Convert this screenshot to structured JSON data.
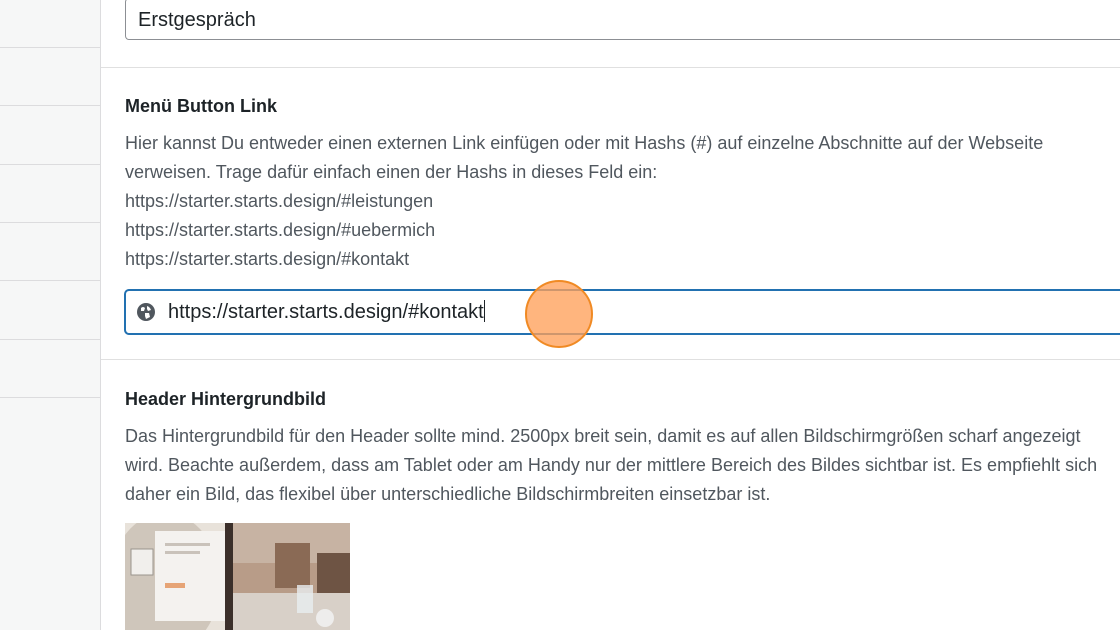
{
  "sidebar": {
    "rows": 8
  },
  "button_text_field": {
    "value": "Erstgespräch"
  },
  "menu_button_link": {
    "label": "Menü Button Link",
    "description_lines": [
      "Hier kannst Du entweder einen externen Link einfügen oder mit Hashs (#) auf einzelne Abschnitte auf der Webseite",
      "verweisen. Trage dafür einfach einen der Hashs in dieses Feld ein:",
      "https://starter.starts.design/#leistungen",
      "https://starter.starts.design/#uebermich",
      "https://starter.starts.design/#kontakt"
    ],
    "input_value": "https://starter.starts.design/#kontakt",
    "input_icon": "globe-icon"
  },
  "header_background": {
    "label": "Header Hintergrundbild",
    "description_lines": [
      "Das Hintergrundbild für den Header sollte mind. 2500px breit sein, damit es auf allen Bildschirmgrößen scharf angezeigt",
      "wird. Beachte außerdem, dass am Tablet oder am Handy nur der mittlere Bereich des Bildes sichtbar ist. Es empfiehlt sich",
      "daher ein Bild, das flexibel über unterschiedliche Bildschirmbreiten einsetzbar ist."
    ]
  },
  "colors": {
    "focus_border": "#2271b1",
    "click_marker": "#f08a24",
    "label_text": "#1d2327",
    "description_text": "#50575e"
  }
}
